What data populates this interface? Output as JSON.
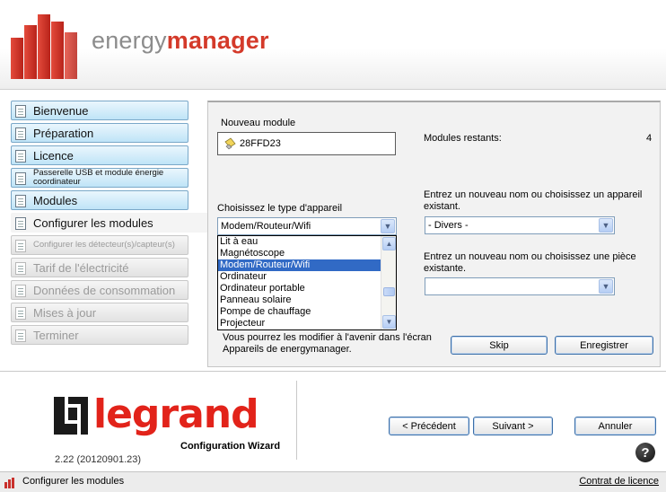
{
  "brand": {
    "part1": "energy",
    "part2": "manager"
  },
  "sidebar": {
    "items": [
      {
        "label": "Bienvenue",
        "state": "enabled"
      },
      {
        "label": "Préparation",
        "state": "enabled"
      },
      {
        "label": "Licence",
        "state": "enabled"
      },
      {
        "label": "Passerelle USB et module énergie coordinateur",
        "state": "enabled"
      },
      {
        "label": "Modules",
        "state": "enabled"
      },
      {
        "label": "Configurer les modules",
        "state": "active"
      },
      {
        "label": "Configurer les détecteur(s)/capteur(s)",
        "state": "disabled"
      },
      {
        "label": "Tarif de l'électricité",
        "state": "disabled"
      },
      {
        "label": "Données de consommation",
        "state": "disabled"
      },
      {
        "label": "Mises à jour",
        "state": "disabled"
      },
      {
        "label": "Terminer",
        "state": "disabled"
      }
    ]
  },
  "main": {
    "new_module_label": "Nouveau module",
    "new_module_value": "28FFD23",
    "remaining_label": "Modules restants:",
    "remaining_count": "4",
    "device_type_label": "Choisissez le type d'appareil",
    "device_type_selected": "Modem/Routeur/Wifi",
    "device_options": [
      "Lit à eau",
      "Magnétoscope",
      "Modem/Routeur/Wifi",
      "Ordinateur",
      "Ordinateur portable",
      "Panneau solaire",
      "Pompe de chauffage",
      "Projecteur"
    ],
    "device_options_selected_index": 2,
    "appliance_label_line1": "Entrez un nouveau nom ou choisissez un appareil",
    "appliance_label_line2": "existant.",
    "appliance_value": "- Divers -",
    "room_label_line1": "Entrez un nouveau nom ou choisissez une pièce",
    "room_label_line2": "existante.",
    "room_value": "",
    "note_line1": "Vous pourrez les modifier à l'avenir dans l'écran",
    "note_line2": "Appareils de energymanager.",
    "skip_label": "Skip",
    "save_label": "Enregistrer"
  },
  "footer": {
    "brand_word": "legrand",
    "wizard_label": "Configuration Wizard",
    "version": "2.22 (20120901.23)",
    "prev_label": "< Précédent",
    "next_label": "Suivant >",
    "cancel_label": "Annuler",
    "help_glyph": "?"
  },
  "statusbar": {
    "text": "Configurer les modules",
    "license_link": "Contrat de licence"
  },
  "colors": {
    "accent_red": "#d43a2a",
    "nav_blue": "#bfe4f7",
    "selection_blue": "#316ac5"
  }
}
